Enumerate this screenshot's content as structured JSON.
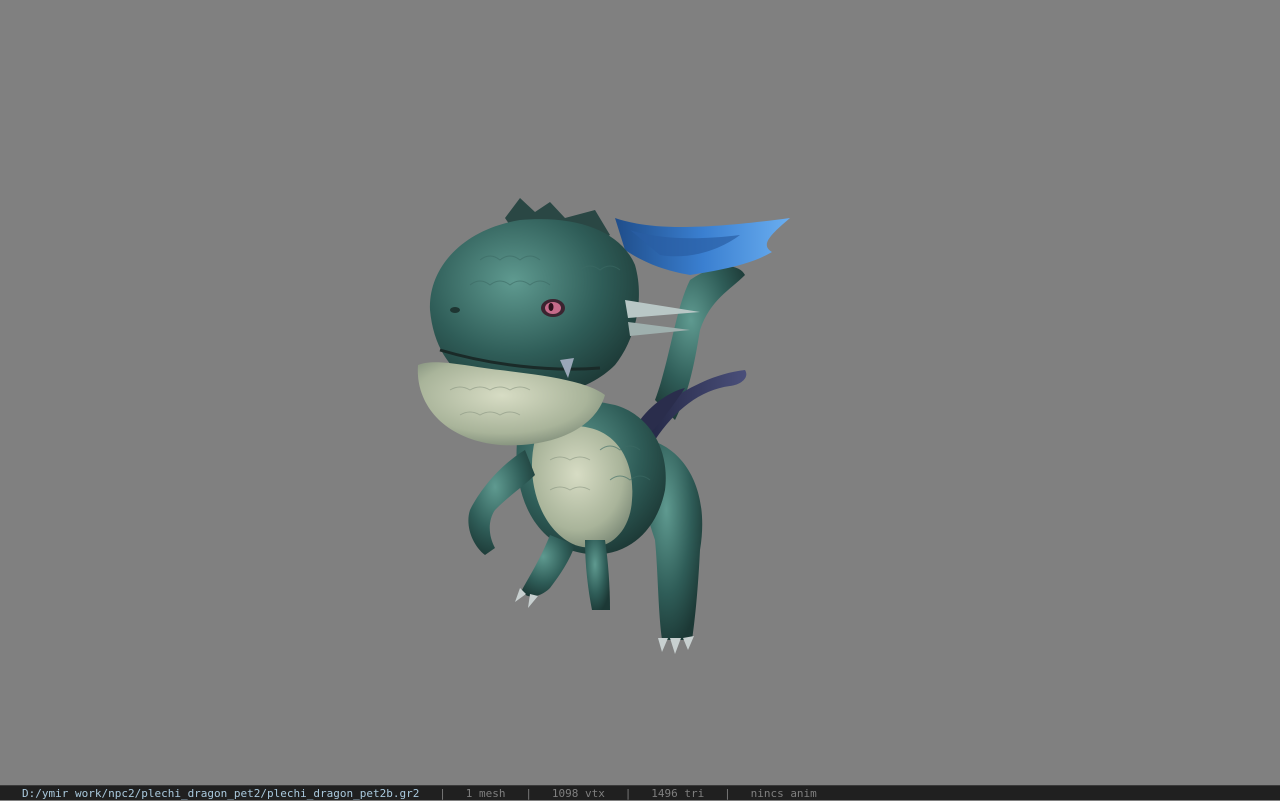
{
  "viewer": {
    "background_color": "#808080",
    "model_name": "plechi_dragon_pet2b",
    "model_icon": "dragon-model"
  },
  "statusbar": {
    "file_path": "D:/ymir work/npc2/plechi_dragon_pet2/plechi_dragon_pet2b.gr2",
    "mesh_count": "1 mesh",
    "vertex_count": "1098 vtx",
    "triangle_count": "1496 tri",
    "anim_status": "nincs anim",
    "separator": "|"
  }
}
